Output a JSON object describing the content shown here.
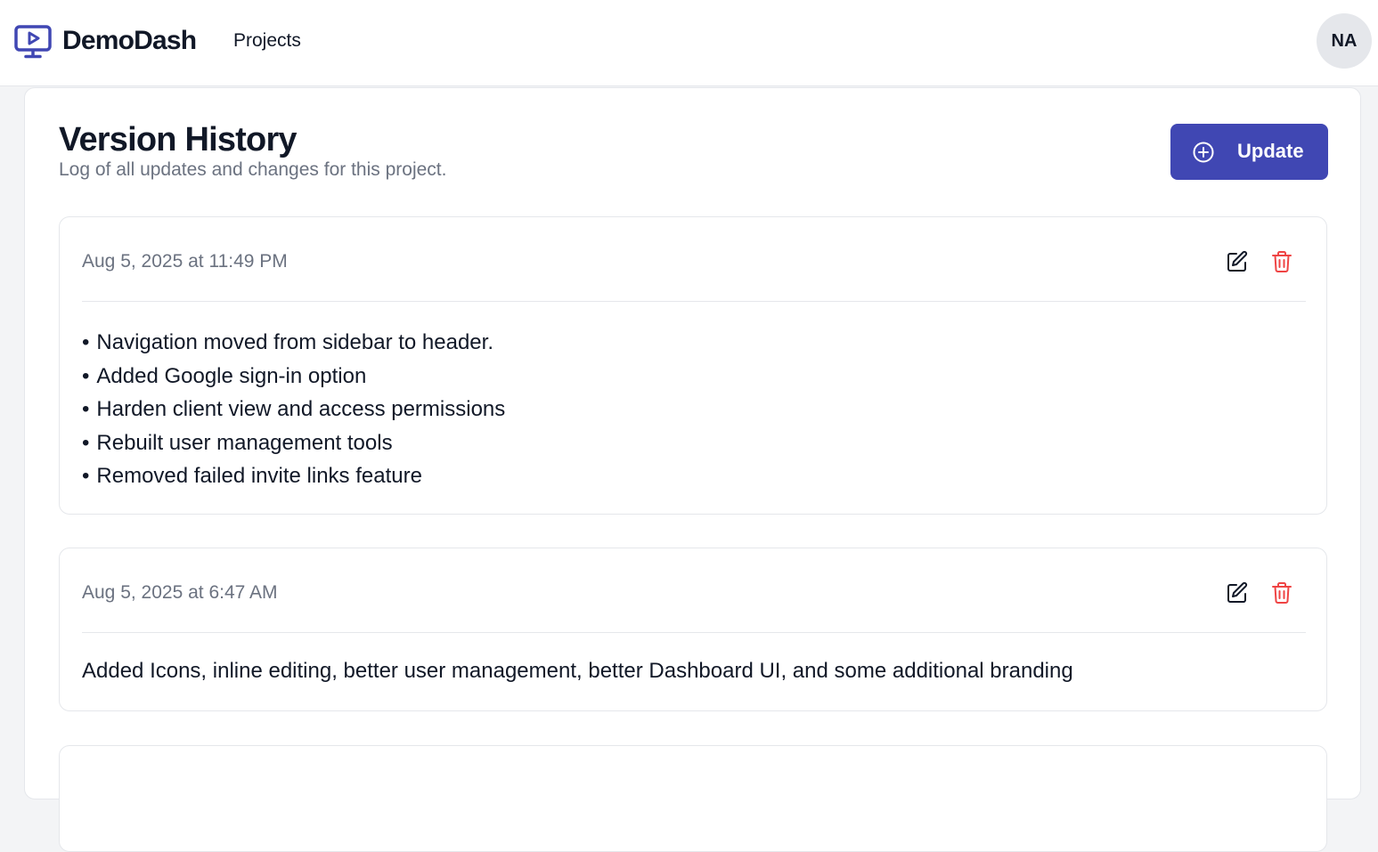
{
  "header": {
    "brand": "DemoDash",
    "nav": [
      {
        "label": "Projects"
      }
    ],
    "avatar_initials": "NA"
  },
  "page": {
    "title": "Version History",
    "subtitle": "Log of all updates and changes for this project.",
    "update_label": "Update"
  },
  "entries": [
    {
      "date": "Aug 5, 2025 at 11:49 PM",
      "items": [
        "Navigation moved from sidebar to header.",
        "Added Google sign-in option",
        "Harden client view and access permissions",
        "Rebuilt user management tools",
        "Removed failed invite links feature"
      ]
    },
    {
      "date": "Aug 5, 2025 at 6:47 AM",
      "text": "Added Icons, inline editing, better user management, better Dashboard UI, and some additional branding"
    }
  ],
  "icons": {
    "logo": "monitor-play-icon",
    "update": "plus-circle-icon",
    "edit": "edit-icon",
    "delete": "trash-icon"
  },
  "colors": {
    "brand": "#4047b3",
    "delete": "#ef4444",
    "muted_text": "#6b7280"
  }
}
